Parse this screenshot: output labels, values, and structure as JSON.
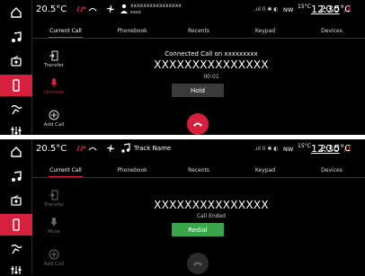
{
  "screen1": {
    "status": {
      "left_temp": "20.5°C",
      "contact_name": "xxxxxxxxxxxxxxxx",
      "contact_sub": "xxxx",
      "right_temp": "20.5°C",
      "time": "12:30",
      "compass": "NW",
      "outside_temp": "15°C"
    },
    "tabs": [
      "Current Call",
      "Phonebook",
      "Recents",
      "Keypad",
      "Devices"
    ],
    "active_tab": "Current Call",
    "actions": [
      {
        "label": "Transfer",
        "icon": "transfer-icon"
      },
      {
        "label": "Unmute",
        "icon": "mic-muted-icon"
      },
      {
        "label": "Add Call",
        "icon": "add-call-icon"
      }
    ],
    "connected_text": "Connected Call on xxxxxxxxx",
    "caller": "XXXXXXXXXXXXXXX",
    "timer": "00:01",
    "hold_label": "Hold",
    "colors": {
      "accent": "#d61f3c",
      "unmute": "#d61f3c"
    }
  },
  "screen2": {
    "status": {
      "left_temp": "20.5°C",
      "track": "Track Name",
      "right_temp": "20.5°C",
      "time": "12:30",
      "compass": "NW",
      "outside_temp": "15°C"
    },
    "tabs": [
      "Current Call",
      "Phonebook",
      "Recents",
      "Keypad",
      "Devices"
    ],
    "active_tab": "Current Call",
    "actions": [
      {
        "label": "Transfer",
        "icon": "transfer-icon"
      },
      {
        "label": "Mute",
        "icon": "mic-icon"
      },
      {
        "label": "Add Call",
        "icon": "add-call-icon"
      }
    ],
    "caller": "XXXXXXXXXXXXXXX",
    "ended_text": "Call Ended",
    "redial_label": "Redial",
    "colors": {
      "redial": "#3aa64a"
    }
  }
}
